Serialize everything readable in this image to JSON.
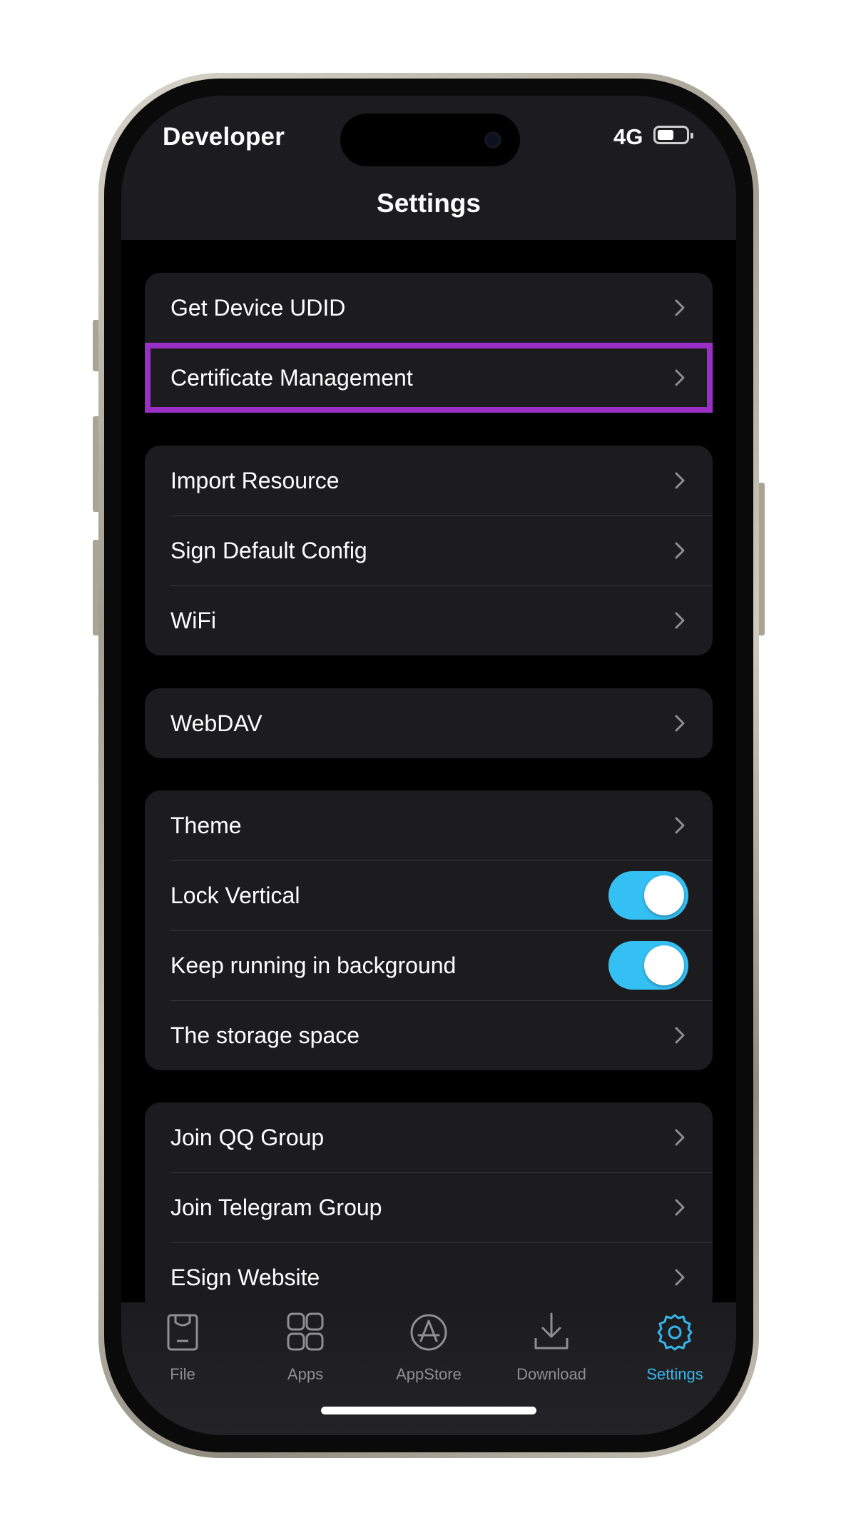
{
  "status_bar": {
    "time_label": "Developer",
    "network": "4G"
  },
  "nav": {
    "title": "Settings"
  },
  "groups": [
    {
      "rows": [
        {
          "label": "Get Device UDID",
          "accessory": "chevron"
        },
        {
          "label": "Certificate Management",
          "accessory": "chevron",
          "highlighted": true
        }
      ]
    },
    {
      "rows": [
        {
          "label": "Import Resource",
          "accessory": "chevron"
        },
        {
          "label": "Sign Default Config",
          "accessory": "chevron"
        },
        {
          "label": "WiFi",
          "accessory": "chevron"
        }
      ]
    },
    {
      "rows": [
        {
          "label": "WebDAV",
          "accessory": "chevron"
        }
      ]
    },
    {
      "rows": [
        {
          "label": "Theme",
          "accessory": "chevron"
        },
        {
          "label": "Lock Vertical",
          "accessory": "toggle",
          "on": true
        },
        {
          "label": "Keep running in background",
          "accessory": "toggle",
          "on": true
        },
        {
          "label": "The storage space",
          "accessory": "chevron"
        }
      ]
    },
    {
      "rows": [
        {
          "label": "Join QQ Group",
          "accessory": "chevron"
        },
        {
          "label": "Join Telegram Group",
          "accessory": "chevron"
        },
        {
          "label": "ESign Website",
          "accessory": "chevron"
        }
      ]
    }
  ],
  "tabbar": {
    "tabs": [
      {
        "label": "File",
        "icon": "bag-icon"
      },
      {
        "label": "Apps",
        "icon": "grid-icon"
      },
      {
        "label": "AppStore",
        "icon": "appstore-icon"
      },
      {
        "label": "Download",
        "icon": "download-icon"
      },
      {
        "label": "Settings",
        "icon": "gear-icon",
        "active": true
      }
    ]
  },
  "colors": {
    "accent": "#34B7EF",
    "toggle_on": "#34C0F3",
    "highlight_box": "#9A2FC7",
    "cell_bg": "#1C1C1E"
  }
}
